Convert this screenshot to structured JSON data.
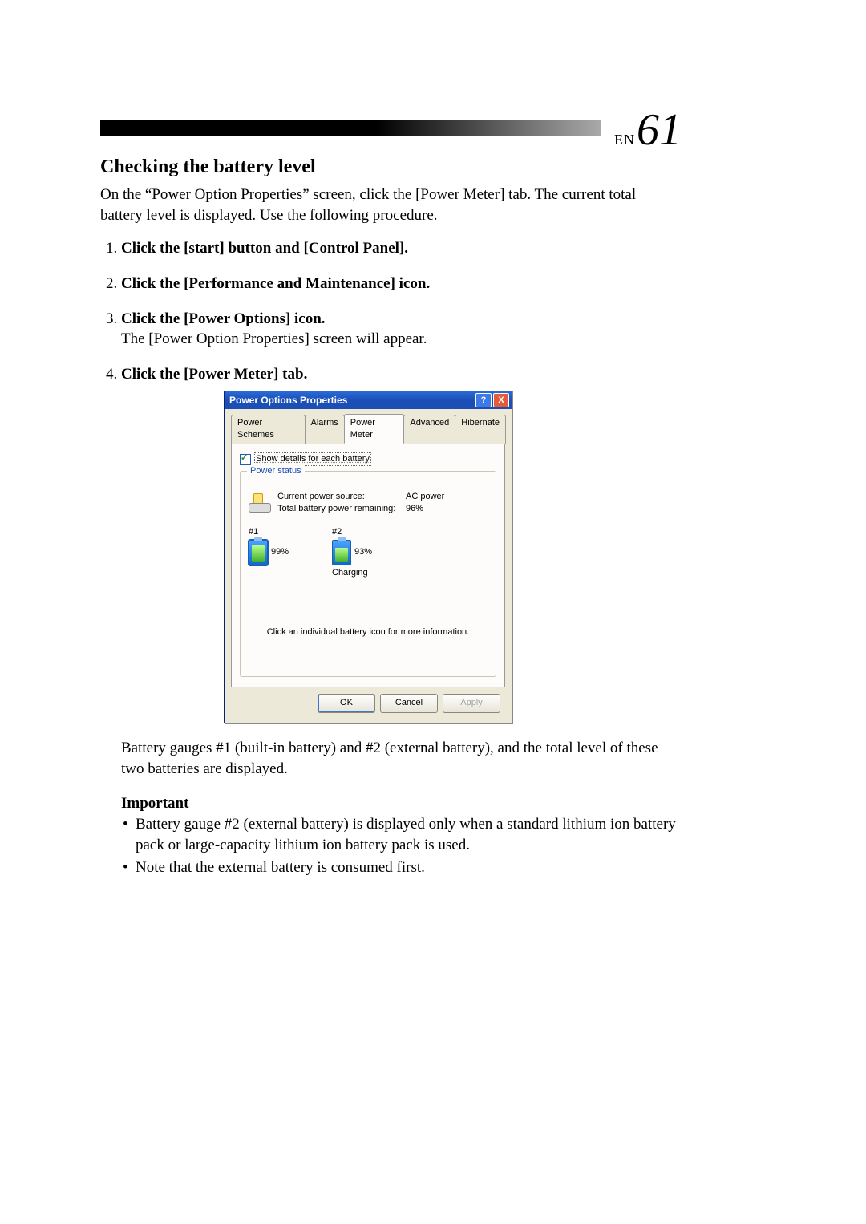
{
  "header": {
    "lang_prefix": "EN",
    "page_number": "61"
  },
  "section_title": "Checking the battery level",
  "intro": "On the “Power Option Properties” screen, click the [Power Meter] tab.  The current total battery level is displayed.  Use the following procedure.",
  "steps": {
    "s1_head": "Click the [start] button and [Control Panel].",
    "s2_head": "Click the [Performance and Maintenance] icon.",
    "s3_head": "Click the [Power Options] icon.",
    "s3_note": "The [Power Option Properties] screen will appear.",
    "s4_head": "Click the [Power Meter] tab."
  },
  "dialog": {
    "title": "Power Options Properties",
    "help_glyph": "?",
    "close_glyph": "X",
    "tabs": {
      "t1": "Power Schemes",
      "t2": "Alarms",
      "t3": "Power Meter",
      "t4": "Advanced",
      "t5": "Hibernate"
    },
    "show_details_label": "Show details for each battery",
    "fieldset_title": "Power status",
    "current_source_label": "Current power source:",
    "current_source_value": "AC power",
    "remaining_label": "Total battery power remaining:",
    "remaining_value": "96%",
    "batt1_head": "#1",
    "batt1_pct": "99%",
    "batt2_head": "#2",
    "batt2_pct": "93%",
    "batt2_status": "Charging",
    "hint": "Click an individual battery icon for more information.",
    "ok": "OK",
    "cancel": "Cancel",
    "apply": "Apply"
  },
  "after": "Battery gauges #1 (built-in battery) and #2 (external battery), and the total level of these two batteries are displayed.",
  "important": {
    "title": "Important",
    "b1": "Battery gauge #2 (external battery) is displayed only when a standard lithium ion battery pack or large-capacity lithium ion battery pack is used.",
    "b2": "Note that the external battery is consumed first."
  }
}
